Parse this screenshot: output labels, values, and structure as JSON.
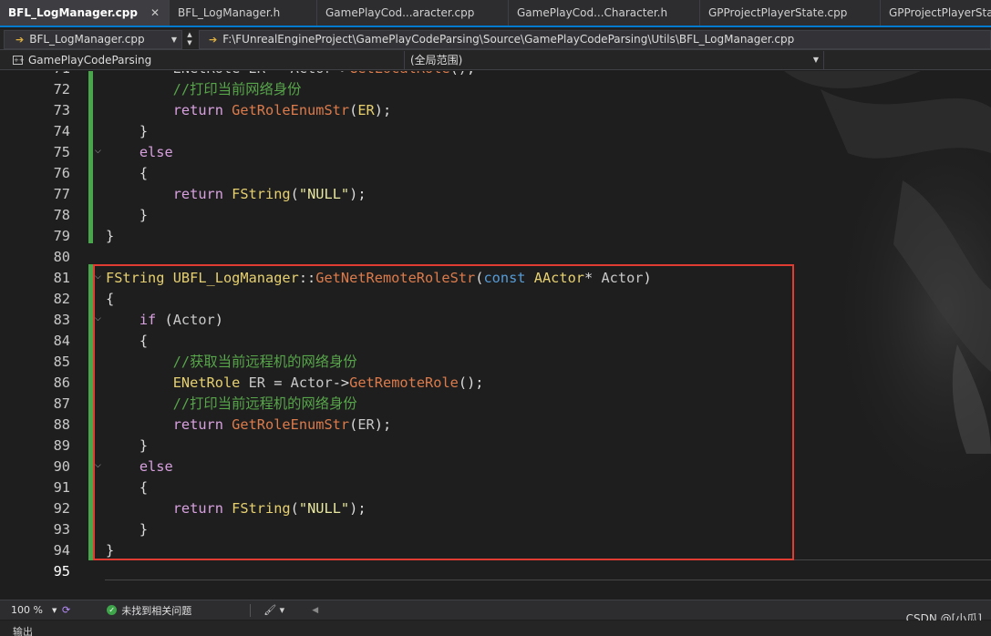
{
  "tabs": [
    {
      "label": "BFL_LogManager.cpp",
      "active": true,
      "close": "✕"
    },
    {
      "label": "BFL_LogManager.h"
    },
    {
      "label": "GamePlayCod...aracter.cpp"
    },
    {
      "label": "GamePlayCod...Character.h"
    },
    {
      "label": "GPProjectPlayerState.cpp"
    },
    {
      "label": "GPProjectPlayerState.h"
    }
  ],
  "nav": {
    "file": "BFL_LogManager.cpp",
    "path": "F:\\FUnrealEngineProject\\GamePlayCodeParsing\\Source\\GamePlayCodeParsing\\Utils\\BFL_LogManager.cpp"
  },
  "scope": {
    "project": "GamePlayCodeParsing",
    "range": "(全局范围)"
  },
  "editor": {
    "lines": [
      {
        "n": "71",
        "html": "<span class=\"muted\">        ENetRole ER = Actor-></span><span class=\"fn\">GetLocalRole</span>();"
      },
      {
        "n": "72",
        "html": "<span class=\"cm\">        //打印当前网络身份</span>"
      },
      {
        "n": "73",
        "html": "        <span class=\"kw\">return</span> <span class=\"fn\">GetRoleEnumStr</span>(<span class=\"tname\">ER</span>);"
      },
      {
        "n": "74",
        "html": "    }"
      },
      {
        "n": "75",
        "html": "    <span class=\"kw\">else</span>"
      },
      {
        "n": "76",
        "html": "    {"
      },
      {
        "n": "77",
        "html": "        <span class=\"kw\">return</span> <span class=\"tname\">FString</span>(<span class=\"str\">\"NULL\"</span>);"
      },
      {
        "n": "78",
        "html": "    }"
      },
      {
        "n": "79",
        "html": "}"
      },
      {
        "n": "80",
        "html": ""
      },
      {
        "n": "81",
        "html": "<span class=\"tname\">FString</span> <span class=\"tname\">UBFL_LogManager</span>::<span class=\"fn\">GetNetRemoteRoleStr</span>(<span class=\"blue\">const</span> <span class=\"tname\">AActor</span>* <span class=\"muted\">Actor</span>)"
      },
      {
        "n": "82",
        "html": "{"
      },
      {
        "n": "83",
        "html": "    <span class=\"kw\">if</span> (<span class=\"muted\">Actor</span>)"
      },
      {
        "n": "84",
        "html": "    {"
      },
      {
        "n": "85",
        "html": "<span class=\"cm\">        //获取当前远程机的网络身份</span>"
      },
      {
        "n": "86",
        "html": "        <span class=\"tname\">ENetRole</span> <span class=\"muted\">ER</span> = <span class=\"muted\">Actor</span>-><span class=\"fn\">GetRemoteRole</span>();"
      },
      {
        "n": "87",
        "html": "<span class=\"cm\">        //打印当前远程机的网络身份</span>"
      },
      {
        "n": "88",
        "html": "        <span class=\"kw\">return</span> <span class=\"fn\">GetRoleEnumStr</span>(<span class=\"muted\">ER</span>);"
      },
      {
        "n": "89",
        "html": "    }"
      },
      {
        "n": "90",
        "html": "    <span class=\"kw\">else</span>"
      },
      {
        "n": "91",
        "html": "    {"
      },
      {
        "n": "92",
        "html": "        <span class=\"kw\">return</span> <span class=\"tname\">FString</span>(<span class=\"str\">\"NULL\"</span>);"
      },
      {
        "n": "93",
        "html": "    }"
      },
      {
        "n": "94",
        "html": "}"
      },
      {
        "n": "95",
        "html": ""
      }
    ],
    "current_line": "95"
  },
  "status": {
    "zoom": "100 %",
    "issues": "未找到相关问题",
    "watermark": "CSDN @[小瓜]"
  },
  "output": {
    "label": "输出"
  }
}
